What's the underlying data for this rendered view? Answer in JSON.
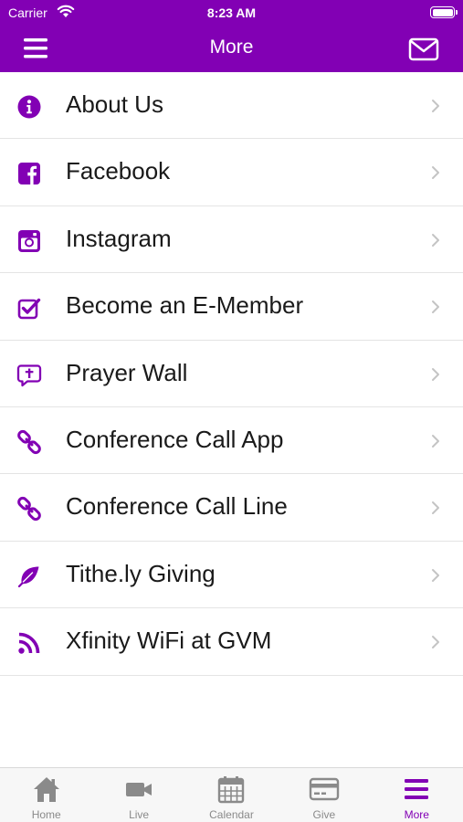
{
  "status_bar": {
    "carrier": "Carrier",
    "time": "8:23 AM"
  },
  "nav": {
    "title": "More",
    "left_icon": "hamburger-menu-icon",
    "right_icon": "envelope-icon"
  },
  "colors": {
    "brand": "#8200b4",
    "inactive_tab": "#8a8a8a",
    "chevron": "#c4c4c4"
  },
  "menu": {
    "items": [
      {
        "label": "About Us",
        "icon": "info-circle-icon"
      },
      {
        "label": "Facebook",
        "icon": "facebook-icon"
      },
      {
        "label": "Instagram",
        "icon": "instagram-icon"
      },
      {
        "label": "Become an E-Member",
        "icon": "checkbox-icon"
      },
      {
        "label": "Prayer Wall",
        "icon": "prayer-bubble-icon"
      },
      {
        "label": "Conference Call App",
        "icon": "link-icon"
      },
      {
        "label": "Conference Call Line",
        "icon": "link-icon"
      },
      {
        "label": "Tithe.ly Giving",
        "icon": "leaf-icon"
      },
      {
        "label": "Xfinity WiFi at GVM",
        "icon": "rss-icon"
      }
    ]
  },
  "tabbar": {
    "tabs": [
      {
        "label": "Home",
        "icon": "home-icon",
        "active": false
      },
      {
        "label": "Live",
        "icon": "video-camera-icon",
        "active": false
      },
      {
        "label": "Calendar",
        "icon": "calendar-icon",
        "active": false
      },
      {
        "label": "Give",
        "icon": "credit-card-icon",
        "active": false
      },
      {
        "label": "More",
        "icon": "menu-icon",
        "active": true
      }
    ]
  }
}
